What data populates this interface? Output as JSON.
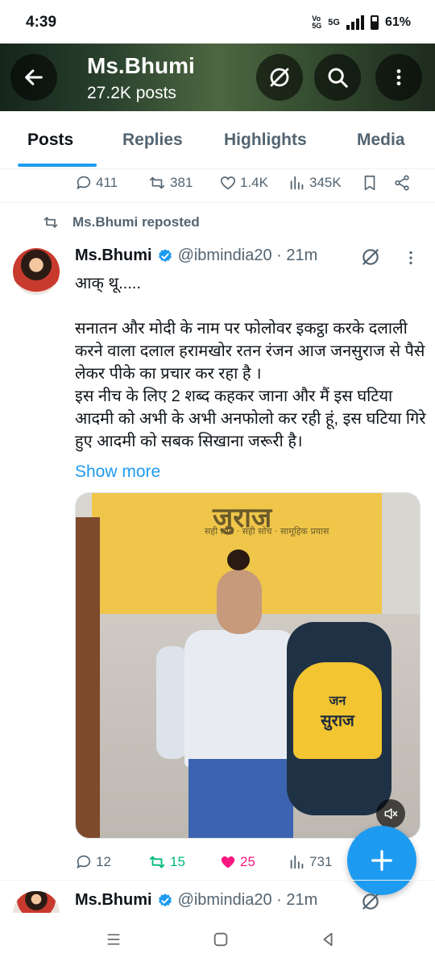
{
  "status_bar": {
    "time": "4:39",
    "network_top": "Vo",
    "network_bottom": "5G",
    "network_type": "5G",
    "battery": "61%"
  },
  "header": {
    "name": "Ms.Bhumi",
    "post_count": "27.2K posts"
  },
  "tabs": [
    "Posts",
    "Replies",
    "Highlights",
    "Media"
  ],
  "prev_tweet_actions": {
    "replies": "411",
    "reposts": "381",
    "likes": "1.4K",
    "views": "345K"
  },
  "tweet": {
    "repost_label": "Ms.Bhumi reposted",
    "name": "Ms.Bhumi",
    "handle_time": "@ibmindia20 · 21m",
    "text": "आक् थू.....\n\nसनातन और मोदी के नाम पर फोलोवर इकट्ठा करके दलाली करने वाला दलाल हरामखोर रतन रंजन आज जनसुराज से पैसे लेकर पीके का प्रचार कर रहा है ।\nइस नीच के लिए 2 शब्द कहकर जाना और मैं इस घटिया आदमी को अभी के अभी अनफोलो कर रही हूं, इस घटिया गिरे हुए आदमी को सबक सिखाना जरूरी है।",
    "show_more": "Show more",
    "media": {
      "banner_text": "जुराज",
      "banner_sub": "सही लोग · सही सोच · सामूहिक प्रयास",
      "bag_line1": "जन",
      "bag_line2": "सुराज"
    },
    "actions": {
      "replies": "12",
      "reposts": "15",
      "likes": "25",
      "views": "731"
    }
  },
  "next_tweet": {
    "name": "Ms.Bhumi",
    "handle_time": "@ibmindia20 · 21m"
  },
  "colors": {
    "accent": "#1d9bf0",
    "retweet_green": "#00ba7c",
    "like_pink": "#f91880",
    "secondary_text": "#536471"
  }
}
